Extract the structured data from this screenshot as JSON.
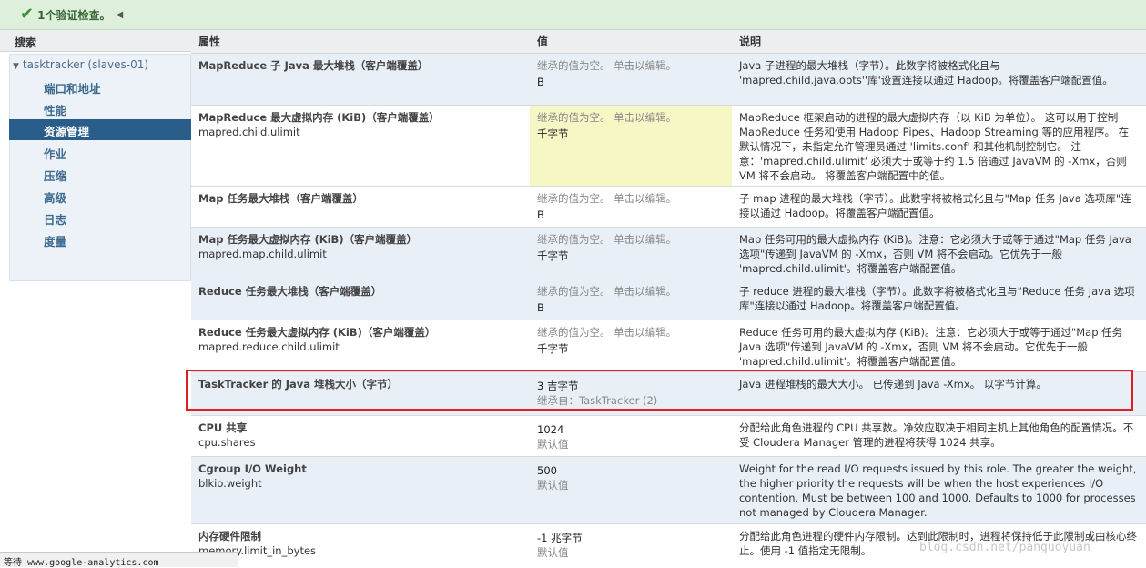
{
  "top_bar": {
    "validation_text": "1个验证检查。",
    "check_icon": "✔",
    "collapse_icon": "◀"
  },
  "sidebar": {
    "header": "搜索",
    "root": "tasktracker (slaves-01)",
    "items": [
      {
        "label": "端口和地址"
      },
      {
        "label": "性能"
      },
      {
        "label": "资源管理"
      },
      {
        "label": "作业"
      },
      {
        "label": "压缩"
      },
      {
        "label": "高级"
      },
      {
        "label": "日志"
      },
      {
        "label": "度量"
      }
    ],
    "active_index": 2
  },
  "table": {
    "headers": {
      "property": "属性",
      "value": "值",
      "description": "说明"
    },
    "rows": [
      {
        "name": "MapReduce 子 Java 最大堆栈（客户端覆盖）",
        "key": "",
        "hint": "继承的值为空。 单击以编辑。",
        "value": "B",
        "desc": "Java 子进程的最大堆栈（字节）。此数字将被格式化且与 'mapred.child.java.opts''库'设置连接以通过 Hadoop。将覆盖客户端配置值。"
      },
      {
        "name": "MapReduce 最大虚拟内存 (KiB)（客户端覆盖）",
        "key": "mapred.child.ulimit",
        "hint": "继承的值为空。 单击以编辑。",
        "value": "千字节",
        "desc": "MapReduce 框架启动的进程的最大虚拟内存（以 KiB 为单位）。 这可以用于控制 MapReduce 任务和使用 Hadoop Pipes、Hadoop Streaming 等的应用程序。 在默认情况下，未指定允许管理员通过 'limits.conf' 和其他机制控制它。 注意：'mapred.child.ulimit' 必须大于或等于约 1.5 倍通过 JavaVM 的 -Xmx，否则 VM 将不会启动。 将覆盖客户端配置中的值。"
      },
      {
        "name": "Map 任务最大堆栈（客户端覆盖）",
        "key": "",
        "hint": "继承的值为空。 单击以编辑。",
        "value": "B",
        "desc": "子 map 进程的最大堆栈（字节）。此数字将被格式化且与\"Map 任务 Java 选项库\"连接以通过 Hadoop。将覆盖客户端配置值。"
      },
      {
        "name": "Map 任务最大虚拟内存 (KiB)（客户端覆盖）",
        "key": "mapred.map.child.ulimit",
        "hint": "继承的值为空。 单击以编辑。",
        "value": "千字节",
        "desc": "Map 任务可用的最大虚拟内存 (KiB)。注意：它必须大于或等于通过\"Map 任务 Java 选项\"传递到 JavaVM 的 -Xmx，否则 VM 将不会启动。它优先于一般 'mapred.child.ulimit'。将覆盖客户端配置值。"
      },
      {
        "name": "Reduce 任务最大堆栈（客户端覆盖）",
        "key": "",
        "hint": "继承的值为空。 单击以编辑。",
        "value": "B",
        "desc": "子 reduce 进程的最大堆栈（字节）。此数字将被格式化且与\"Reduce 任务 Java 选项库\"连接以通过 Hadoop。将覆盖客户端配置值。"
      },
      {
        "name": "Reduce 任务最大虚拟内存 (KiB)（客户端覆盖）",
        "key": "mapred.reduce.child.ulimit",
        "hint": "继承的值为空。 单击以编辑。",
        "value": "千字节",
        "desc": "Reduce 任务可用的最大虚拟内存 (KiB)。注意：它必须大于或等于通过\"Map 任务 Java 选项\"传递到 JavaVM 的 -Xmx，否则 VM 将不会启动。它优先于一般 'mapred.child.ulimit'。将覆盖客户端配置值。"
      },
      {
        "name": "TaskTracker 的 Java 堆栈大小（字节）",
        "key": "",
        "hint": "",
        "value": "3 吉字节",
        "inherit": "继承自：TaskTracker (2)",
        "desc": "Java 进程堆栈的最大大小。 已传递到 Java -Xmx。 以字节计算。"
      },
      {
        "name": "CPU 共享",
        "key": "cpu.shares",
        "hint": "",
        "value": "1024",
        "inherit": "默认值",
        "desc": "分配给此角色进程的 CPU 共享数。净效应取决于相同主机上其他角色的配置情况。不受 Cloudera Manager 管理的进程将获得 1024 共享。"
      },
      {
        "name": "Cgroup I/O Weight",
        "key": "blkio.weight",
        "hint": "",
        "value": "500",
        "inherit": "默认值",
        "desc": "Weight for the read I/O requests issued by this role. The greater the weight, the higher priority the requests will be when the host experiences I/O contention. Must be between 100 and 1000. Defaults to 1000 for processes not managed by Cloudera Manager."
      },
      {
        "name": "内存硬件限制",
        "key": "memory.limit_in_bytes",
        "hint": "",
        "value": "-1 兆字节",
        "inherit": "默认值",
        "desc": "分配给此角色进程的硬件内存限制。达到此限制时，进程将保持低于此限制或由核心终止。使用 -1 值指定无限制。"
      }
    ]
  },
  "status_bar": {
    "text": "等待 www.google-analytics.com"
  },
  "watermark": "blog.csdn.net/panguoyuan"
}
